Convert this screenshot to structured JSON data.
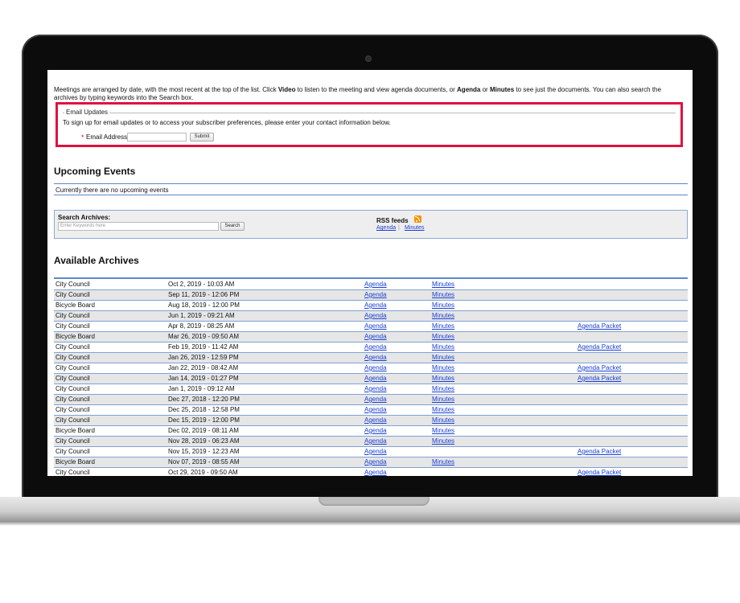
{
  "intro": {
    "text_1": "Meetings are arranged by date, with the most recent at the top of the list. Click ",
    "video": "Video",
    "text_2": " to listen to the meeting and view agenda documents, or ",
    "agenda": "Agenda",
    "text_3": " or ",
    "minutes": "Minutes",
    "text_4": " to see just the documents. You can also search the archives by typing keywords into the Search box."
  },
  "email_updates": {
    "legend": "Email Updates",
    "description": "To sign up for email updates or to access your subscriber preferences, please enter your contact information below.",
    "required_mark": "*",
    "label": "Email Address",
    "value": "",
    "submit_label": "Submit",
    "highlight_color": "#e0113f"
  },
  "upcoming": {
    "title": "Upcoming Events",
    "empty_message": "Currently there are no upcoming events"
  },
  "search": {
    "label": "Search Archives:",
    "placeholder": "Enter Keywords here",
    "button_label": "Search",
    "rss_title": "RSS feeds",
    "rss_agenda": "Agenda",
    "rss_separator": "|",
    "rss_minutes": "Minutes",
    "rss_icon": "rss-icon"
  },
  "archives": {
    "title": "Available Archives",
    "rows": [
      {
        "name": "City Council",
        "date": "Oct  2, 2019 - 10:03 AM",
        "agenda": "Agenda",
        "minutes": "Minutes",
        "packet": ""
      },
      {
        "name": "City Council",
        "date": "Sep 11, 2019 - 12:06 PM",
        "agenda": "Agenda",
        "minutes": "Minutes",
        "packet": ""
      },
      {
        "name": "Bicycle Board",
        "date": "Aug 18, 2019 - 12:00 PM",
        "agenda": "Agenda",
        "minutes": "Minutes",
        "packet": ""
      },
      {
        "name": "City Council",
        "date": "Jun  1, 2019 - 09:21 AM",
        "agenda": "Agenda",
        "minutes": "Minutes",
        "packet": ""
      },
      {
        "name": "City Council",
        "date": "Apr  8, 2019 - 08:25 AM",
        "agenda": "Agenda",
        "minutes": "Minutes",
        "packet": "Agenda Packet"
      },
      {
        "name": "Bicycle Board",
        "date": "Mar 26, 2019 - 09:50 AM",
        "agenda": "Agenda",
        "minutes": "Minutes",
        "packet": ""
      },
      {
        "name": "City Council",
        "date": "Feb 19, 2019 - 11:42 AM",
        "agenda": "Agenda",
        "minutes": "Minutes",
        "packet": "Agenda Packet"
      },
      {
        "name": "City Council",
        "date": "Jan 26, 2019 - 12:59 PM",
        "agenda": "Agenda",
        "minutes": "Minutes",
        "packet": ""
      },
      {
        "name": "City Council",
        "date": "Jan 22, 2019 - 08:42 AM",
        "agenda": "Agenda",
        "minutes": "Minutes",
        "packet": "Agenda Packet"
      },
      {
        "name": "City Council",
        "date": "Jan 14, 2019 - 01:27 PM",
        "agenda": "Agenda",
        "minutes": "Minutes",
        "packet": "Agenda Packet"
      },
      {
        "name": "City Council",
        "date": "Jan  1, 2019 - 09:12 AM",
        "agenda": "Agenda",
        "minutes": "Minutes",
        "packet": ""
      },
      {
        "name": "City Council",
        "date": "Dec 27, 2018 - 12:20 PM",
        "agenda": "Agenda",
        "minutes": "Minutes",
        "packet": ""
      },
      {
        "name": "City Council",
        "date": "Dec 25, 2018 - 12:58 PM",
        "agenda": "Agenda",
        "minutes": "Minutes",
        "packet": ""
      },
      {
        "name": "City Council",
        "date": "Dec 15, 2019 - 12:00 PM",
        "agenda": "Agenda",
        "minutes": "Minutes",
        "packet": ""
      },
      {
        "name": "Bicycle Board",
        "date": "Dec 02, 2019 - 08:11 AM",
        "agenda": "Agenda",
        "minutes": "Minutes",
        "packet": ""
      },
      {
        "name": "City Council",
        "date": "Nov 28, 2019 - 06:23 AM",
        "agenda": "Agenda",
        "minutes": "Minutes",
        "packet": ""
      },
      {
        "name": "City Council",
        "date": "Nov 15, 2019 - 12:23 AM",
        "agenda": "Agenda",
        "minutes": "",
        "packet": "Agenda Packet"
      },
      {
        "name": "Bicycle Board",
        "date": "Nov 07, 2019 - 08:55 AM",
        "agenda": "Agenda",
        "minutes": "Minutes",
        "packet": ""
      },
      {
        "name": "City Council",
        "date": "Oct 29, 2019 - 09:50 AM",
        "agenda": "Agenda",
        "minutes": "",
        "packet": "Agenda Packet"
      }
    ]
  },
  "colors": {
    "link": "#1a3fd1",
    "rule": "#5b88c9",
    "row_alt": "#e6e6e6",
    "rss": "#f39200"
  }
}
